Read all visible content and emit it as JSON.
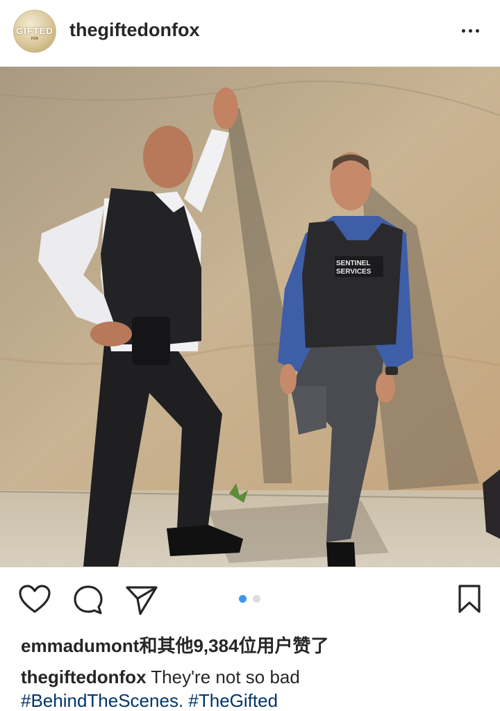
{
  "header": {
    "username": "thegiftedonfox",
    "avatar_text": "GIFTED",
    "avatar_subtext": "FOX",
    "more_icon": "more-horizontal-icon"
  },
  "photo": {
    "vest_label_line1": "SENTINEL",
    "vest_label_line2": "SERVICES"
  },
  "actions": {
    "like_icon": "heart-outline-icon",
    "comment_icon": "comment-bubble-icon",
    "share_icon": "paper-plane-icon",
    "save_icon": "bookmark-outline-icon",
    "carousel": {
      "total": 2,
      "active": 1,
      "active_color": "#3897f0",
      "inactive_color": "#dbdbdb"
    }
  },
  "likes": {
    "text": "emmadumont和其他9,384位用户赞了"
  },
  "caption": {
    "username": "thegiftedonfox",
    "text": " They're not so bad",
    "hashtag1": "#BehindTheScenes.",
    "hashtag2": "#TheGifted"
  }
}
